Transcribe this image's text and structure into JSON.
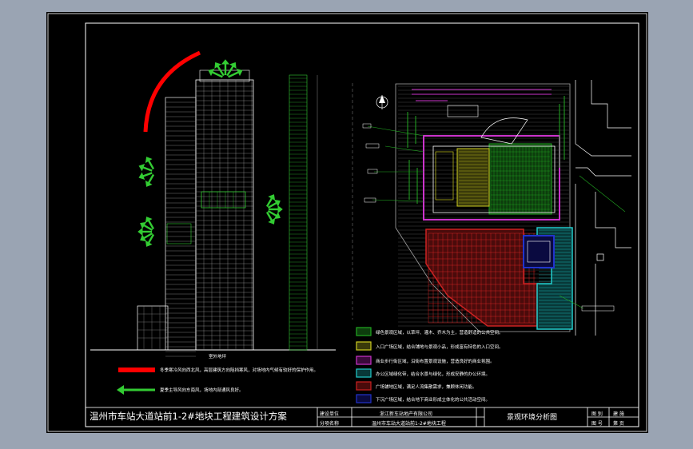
{
  "colors": {
    "background": "#9aa4b3",
    "sheet": "#000000",
    "frame": "#ffffff",
    "wind_arc": "#ff0000",
    "wind_arrow": "#33cc33",
    "green_area": "#22aa22",
    "yellow_area": "#cccc22",
    "magenta_area": "#cc33cc",
    "cyan_area": "#22cccc",
    "red_area": "#cc2222",
    "blue_area": "#2233cc"
  },
  "title_block": {
    "project_title": "温州市车站大道站前1-2#地块工程建筑设计方案",
    "owner_label": "建设单位",
    "owner_value": "浙江新车站地产有限公司",
    "project_label": "分项名称",
    "project_value": "温州市车站大道站前1-2#地块工程",
    "drawing_title": "景观环境分析图",
    "sheet_label": "图 别",
    "sheet_value": "建 施",
    "number_label": "图 号",
    "number_value": "第 页"
  },
  "elevation": {
    "legend_wind_red": "冬季寒冷风向西北风，高层建筑方向阻挡寒风，对场地内气候有较好的保护作用。",
    "legend_wind_green": "夏季主导风向东南风，场地内部通风良好。",
    "ground_label": "室外地坪"
  },
  "site_plan": {
    "north_label": "N",
    "legend": [
      {
        "swatch": "green",
        "text": "绿色景观区域，以草坪、灌木、乔木为主，营造舒适的公共空间。"
      },
      {
        "swatch": "yellow",
        "text": "入口广场区域，结合铺地与景观小品，形成富有特色的入口空间。"
      },
      {
        "swatch": "magenta",
        "text": "商业步行街区域，沿街布置景观设施，营造良好的商业氛围。"
      },
      {
        "swatch": "cyan",
        "text": "办公区域绿化带，结合水景与绿化，形成安静的办公环境。"
      },
      {
        "swatch": "red",
        "text": "广场铺地区域，满足人流集散需求，兼顾休闲功能。"
      },
      {
        "swatch": "blue",
        "text": "下沉广场区域，结合地下商业形成立体化的公共活动空间。"
      }
    ]
  }
}
